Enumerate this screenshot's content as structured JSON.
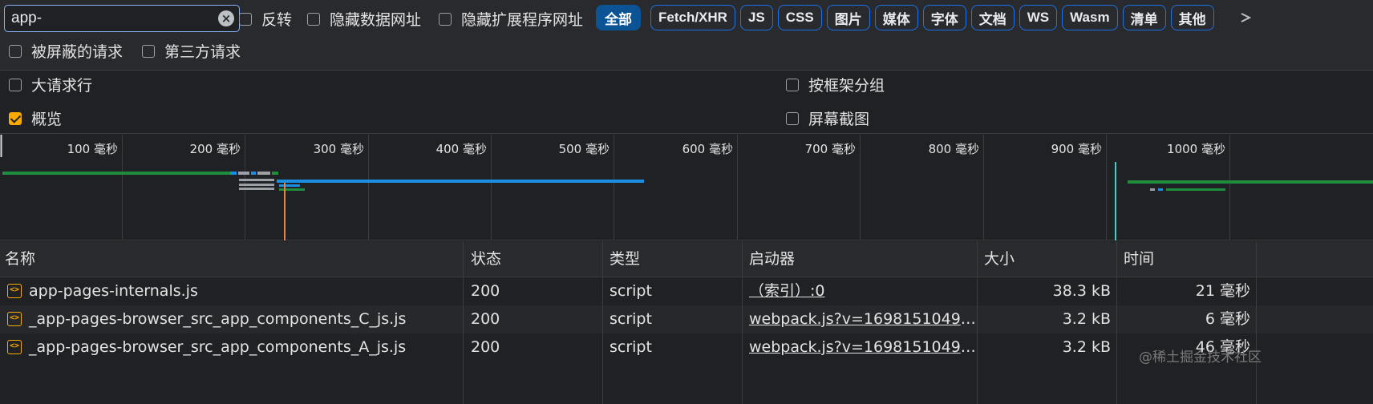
{
  "search": {
    "value": "app-"
  },
  "filters": {
    "invert": "反转",
    "hide_data_urls": "隐藏数据网址",
    "hide_extension_urls": "隐藏扩展程序网址",
    "all": "全部",
    "types": [
      "Fetch/XHR",
      "JS",
      "CSS",
      "图片",
      "媒体",
      "字体",
      "文档",
      "WS",
      "Wasm",
      "清单",
      "其他"
    ],
    "blocked_requests": "被屏蔽的请求",
    "third_party": "第三方请求"
  },
  "settings": {
    "big_rows": "大请求行",
    "group_by_frame": "按框架分组",
    "overview": "概览",
    "screenshots": "屏幕截图",
    "overview_checked": true
  },
  "timeline": {
    "ticks": [
      "100 毫秒",
      "200 毫秒",
      "300 毫秒",
      "400 毫秒",
      "500 毫秒",
      "600 毫秒",
      "700 毫秒",
      "800 毫秒",
      "900 毫秒",
      "1000 毫秒"
    ]
  },
  "table": {
    "headers": {
      "name": "名称",
      "status": "状态",
      "type": "类型",
      "initiator": "启动器",
      "size": "大小",
      "time": "时间"
    },
    "rows": [
      {
        "name": "app-pages-internals.js",
        "status": "200",
        "type": "script",
        "initiator": "（索引）:0",
        "size": "38.3 kB",
        "time": "21 毫秒"
      },
      {
        "name": "_app-pages-browser_src_app_components_C_js.js",
        "status": "200",
        "type": "script",
        "initiator": "webpack.js?v=16981510492…",
        "size": "3.2 kB",
        "time": "6 毫秒"
      },
      {
        "name": "_app-pages-browser_src_app_components_A_js.js",
        "status": "200",
        "type": "script",
        "initiator": "webpack.js?v=16981510492…",
        "size": "3.2 kB",
        "time": "46 毫秒"
      }
    ]
  },
  "watermark": "@稀土掘金技术社区",
  "colors": {
    "accent": "#1a73e8",
    "checkbox": "#f9ab00",
    "green": "#1e8e3e",
    "blue": "#1a8fe3"
  }
}
